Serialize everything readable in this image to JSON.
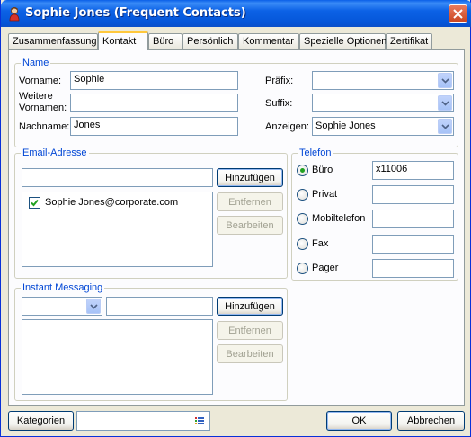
{
  "window": {
    "title": "Sophie Jones (Frequent Contacts)"
  },
  "tabs": [
    "Zusammenfassung",
    "Kontakt",
    "Büro",
    "Persönlich",
    "Kommentar",
    "Spezielle Optionen",
    "Zertifikat"
  ],
  "active_tab": "Kontakt",
  "name": {
    "legend": "Name",
    "vorname_label": "Vorname:",
    "vorname_value": "Sophie",
    "weitere_label_1": "Weitere",
    "weitere_label_2": "Vornamen:",
    "weitere_value": "",
    "nachname_label": "Nachname:",
    "nachname_value": "Jones",
    "praefix_label": "Präfix:",
    "praefix_value": "",
    "suffix_label": "Suffix:",
    "suffix_value": "",
    "anzeigen_label": "Anzeigen:",
    "anzeigen_value": "Sophie Jones"
  },
  "email": {
    "legend": "Email-Adresse",
    "input_value": "",
    "add_label": "Hinzufügen",
    "remove_label": "Entfernen",
    "edit_label": "Bearbeiten",
    "items": [
      "Sophie Jones@corporate.com"
    ]
  },
  "telefon": {
    "legend": "Telefon",
    "options": [
      {
        "label": "Büro",
        "value": "x11006",
        "selected": true
      },
      {
        "label": "Privat",
        "value": "",
        "selected": false
      },
      {
        "label": "Mobiltelefon",
        "value": "",
        "selected": false
      },
      {
        "label": "Fax",
        "value": "",
        "selected": false
      },
      {
        "label": "Pager",
        "value": "",
        "selected": false
      }
    ]
  },
  "im": {
    "legend": "Instant Messaging",
    "service_value": "",
    "address_value": "",
    "add_label": "Hinzufügen",
    "remove_label": "Entfernen",
    "edit_label": "Bearbeiten"
  },
  "footer": {
    "kategorien_label": "Kategorien",
    "kategorien_value": "",
    "ok_label": "OK",
    "cancel_label": "Abbrechen"
  }
}
